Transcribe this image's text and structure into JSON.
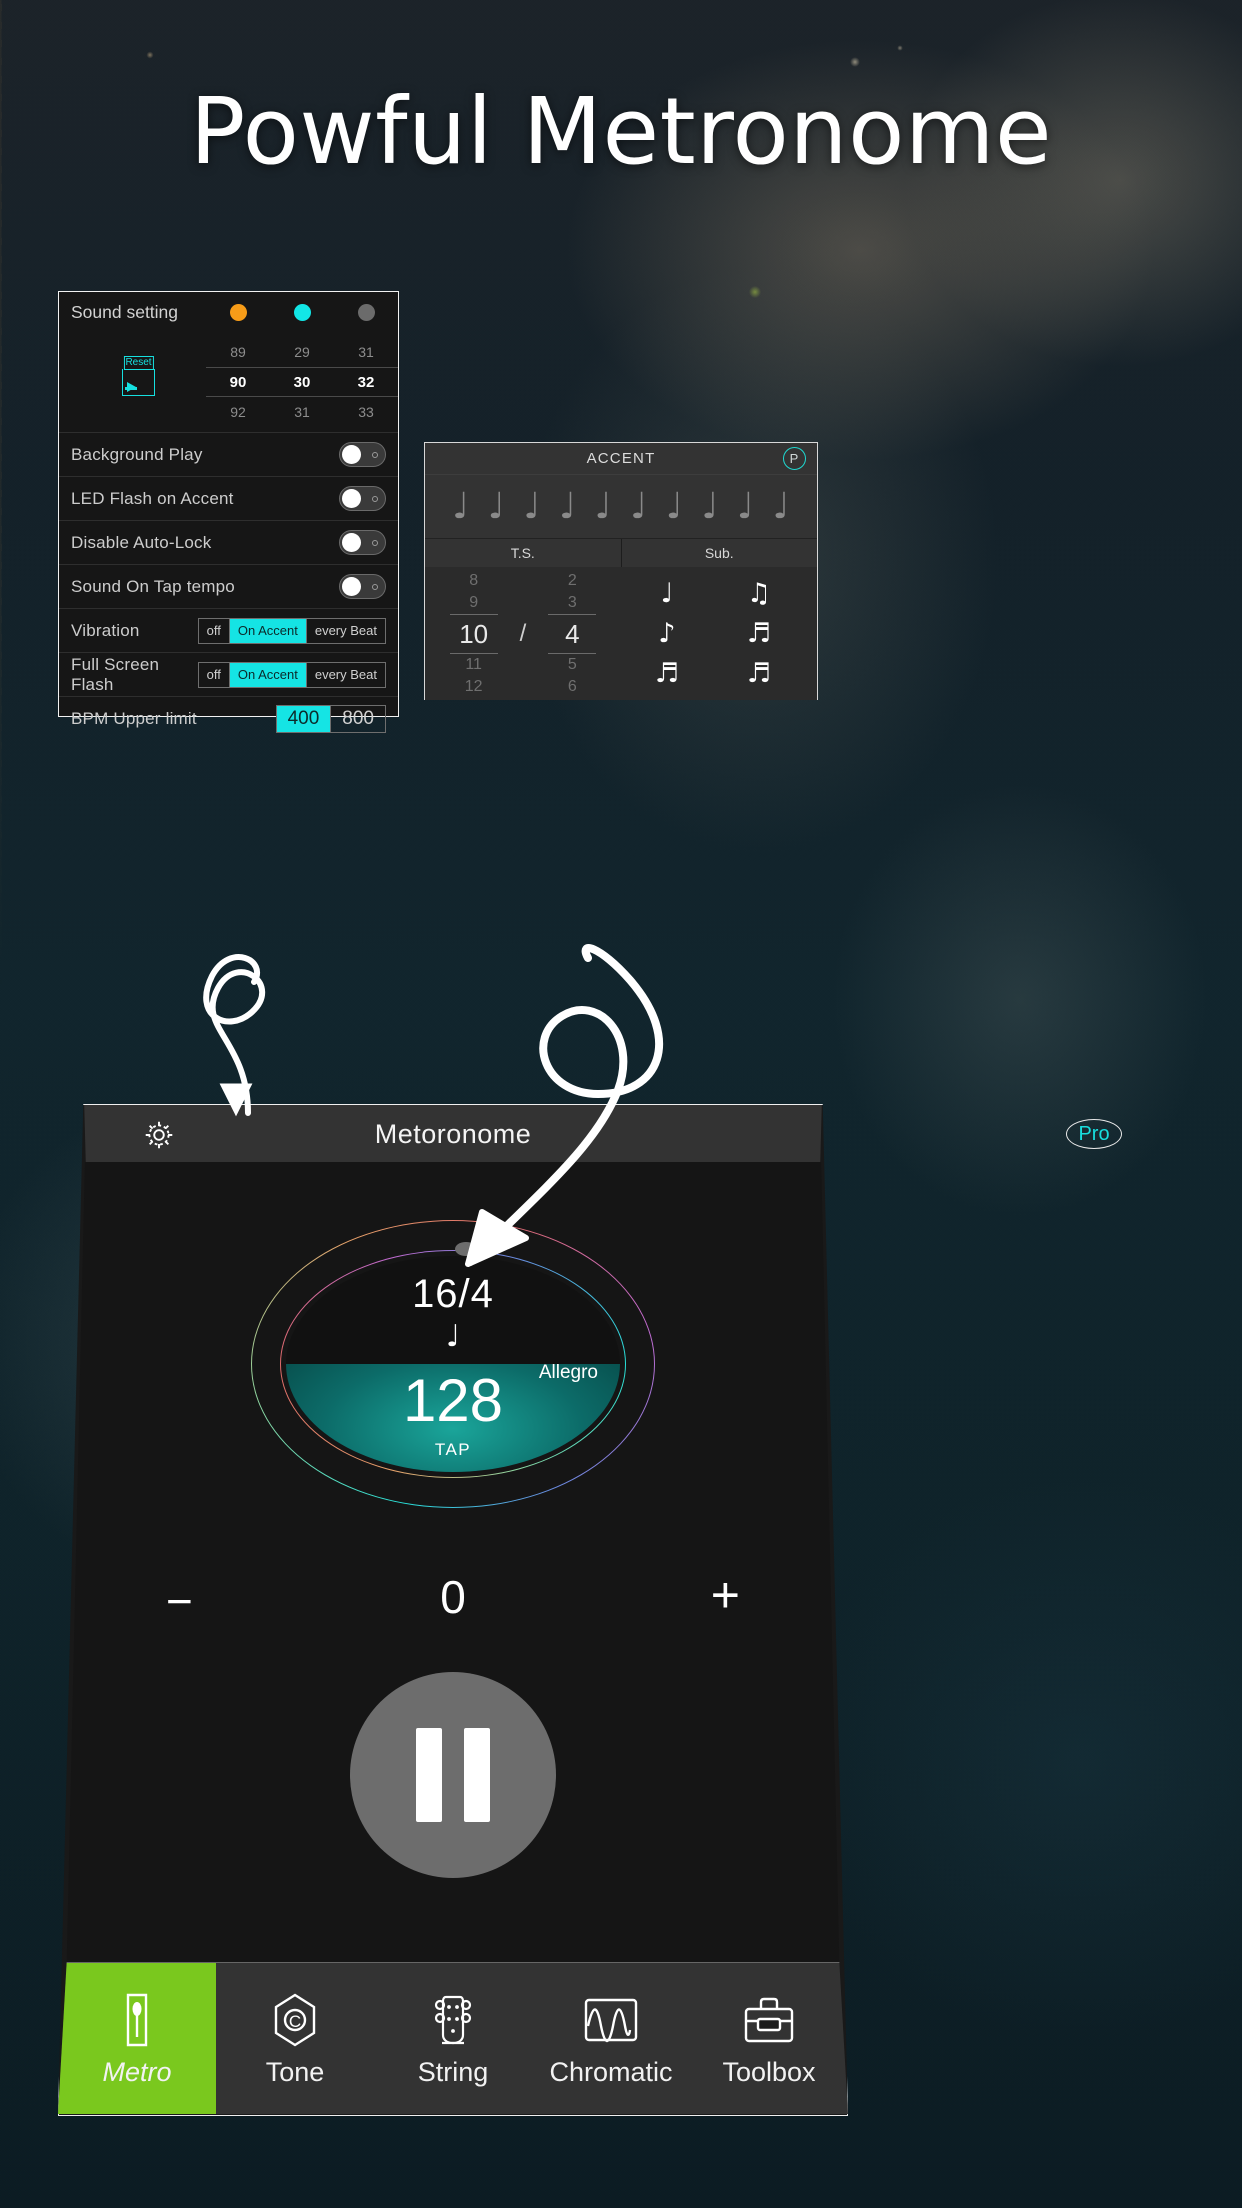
{
  "hero": {
    "title": "Powful Metronome"
  },
  "settings_panel": {
    "sound_setting": {
      "label": "Sound setting",
      "channels": [
        {
          "dot_color": "#f79c18",
          "dot_name": "accent-dot-orange",
          "values": [
            "89",
            "90",
            "92"
          ],
          "selected": "90"
        },
        {
          "dot_color": "#12e6e6",
          "dot_name": "accent-dot-cyan",
          "values": [
            "29",
            "30",
            "31"
          ],
          "selected": "30"
        },
        {
          "dot_color": "#6b6b6b",
          "dot_name": "accent-dot-grey",
          "values": [
            "31",
            "32",
            "33"
          ],
          "selected": "32"
        }
      ],
      "reset_label": "Reset"
    },
    "toggles": [
      {
        "label": "Background Play",
        "on": false
      },
      {
        "label": "LED Flash on Accent",
        "on": false
      },
      {
        "label": "Disable Auto-Lock",
        "on": false
      },
      {
        "label": "Sound On Tap tempo",
        "on": false
      }
    ],
    "segments": [
      {
        "label": "Vibration",
        "options": [
          "off",
          "On Accent",
          "every Beat"
        ],
        "selected": "On Accent"
      },
      {
        "label": "Full Screen Flash",
        "options": [
          "off",
          "On Accent",
          "every Beat"
        ],
        "selected": "On Accent"
      }
    ],
    "bpm_limit": {
      "label": "BPM Upper limit",
      "options": [
        "400",
        "800"
      ],
      "selected": "400"
    },
    "accent_color": "#15e4e4"
  },
  "accent_panel": {
    "title": "ACCENT",
    "pro_badge": "P",
    "notes": [
      "♩",
      "♩",
      "♩",
      "♩",
      "♩",
      "♩",
      "♩",
      "♩",
      "♩",
      "♩"
    ],
    "tabs": [
      "T.S.",
      "Sub."
    ],
    "time_signature": {
      "numerator_values": [
        "8",
        "9",
        "10",
        "11",
        "12"
      ],
      "numerator_selected": "10",
      "separator": "/",
      "denominator_values": [
        "2",
        "3",
        "4",
        "5",
        "6"
      ],
      "denominator_selected": "4"
    },
    "subdivisions": [
      "♩",
      "♫",
      "♪",
      "♬",
      "♬",
      "♬"
    ]
  },
  "phone": {
    "header": {
      "title": "Metoronome",
      "gear_icon": "gear-icon",
      "pro_badge": "Pro"
    },
    "dial": {
      "time_signature": "16/4",
      "note_symbol": "♩",
      "bpm": "128",
      "tempo_name": "Allegro",
      "tap_label": "TAP"
    },
    "counter": {
      "minus": "−",
      "value": "0",
      "plus": "+"
    },
    "transport": {
      "state": "pause"
    },
    "tabs": [
      {
        "label": "Metro",
        "icon": "metronome-icon",
        "active": true
      },
      {
        "label": "Tone",
        "icon": "tone-icon",
        "active": false
      },
      {
        "label": "String",
        "icon": "string-icon",
        "active": false
      },
      {
        "label": "Chromatic",
        "icon": "chromatic-icon",
        "active": false
      },
      {
        "label": "Toolbox",
        "icon": "toolbox-icon",
        "active": false
      }
    ],
    "active_tab_color": "#7ac81e"
  }
}
